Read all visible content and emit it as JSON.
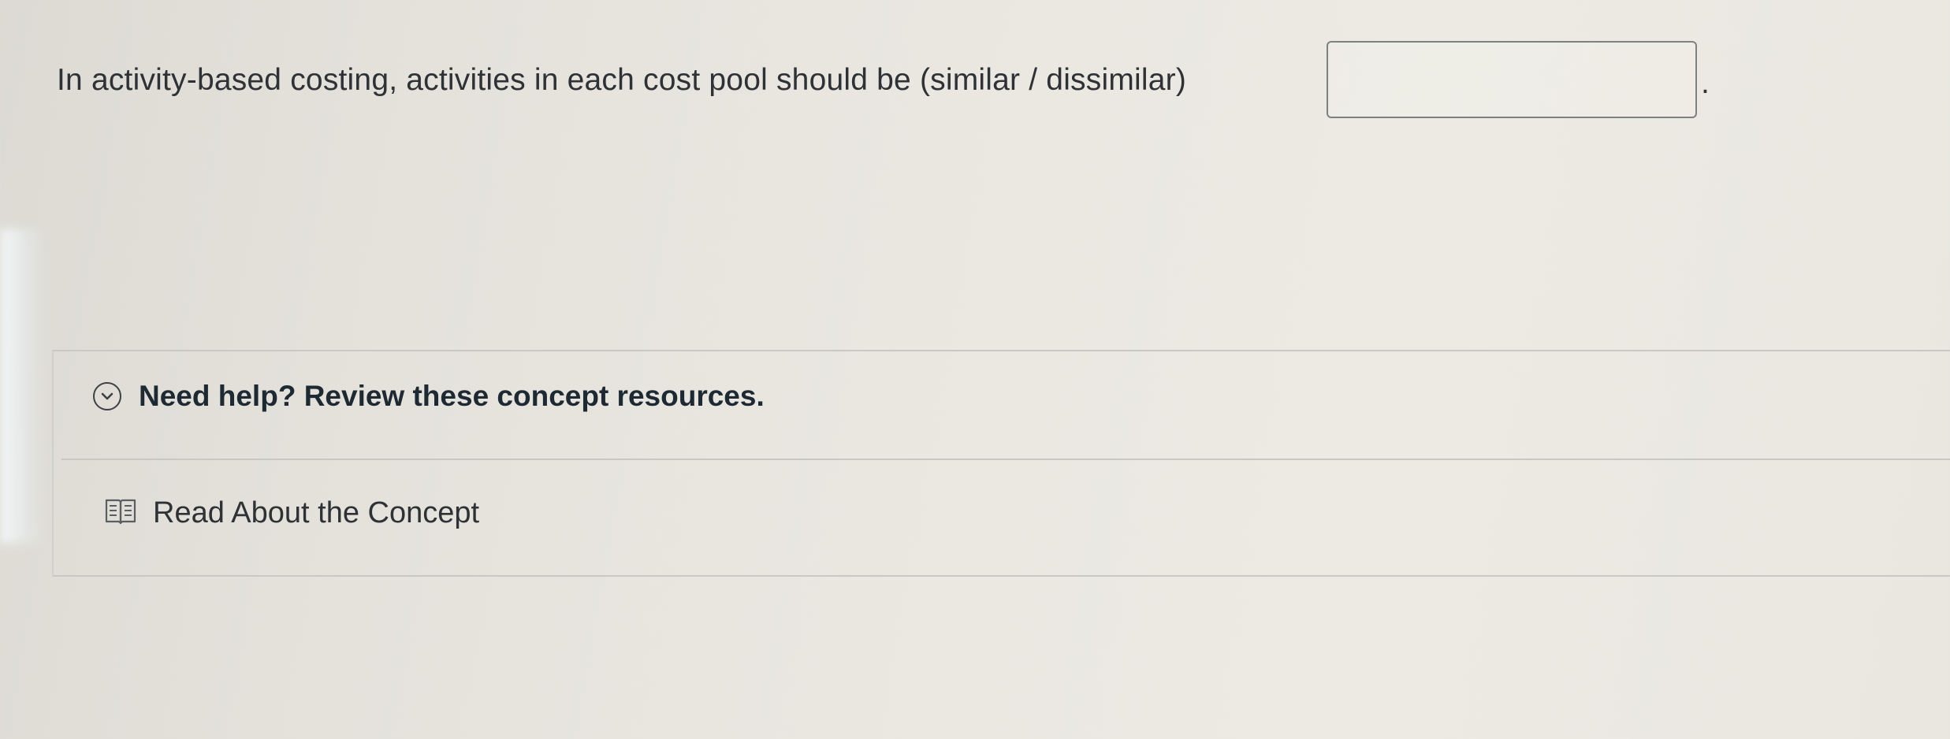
{
  "question": {
    "text": "In activity-based costing, activities in each cost pool should be (similar / dissimilar)",
    "answer_value": "",
    "trailing_punctuation": "."
  },
  "help": {
    "title": "Need help? Review these concept resources.",
    "toggle_icon": "chevron-down-circle-icon",
    "resources": [
      {
        "label": "Read About the Concept",
        "icon": "book-icon"
      }
    ]
  }
}
